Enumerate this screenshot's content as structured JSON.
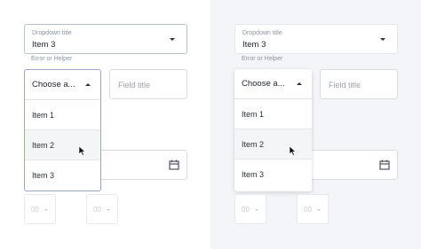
{
  "left": {
    "dropdown_label": "Dropdown title",
    "dropdown_value": "Item 3",
    "helper": "Error or Helper",
    "open_select": {
      "placeholder": "Choose a...",
      "items": [
        "Item 1",
        "Item 2",
        "Item 3"
      ],
      "hovered_item": "Item 2"
    },
    "field_title": "Field title",
    "time_hours": "00",
    "time_minutes": "00"
  },
  "right": {
    "dropdown_label": "Dropdown title",
    "dropdown_value": "Item 3",
    "helper": "Error or Helper",
    "open_select": {
      "placeholder": "Choose a...",
      "items": [
        "Item 1",
        "Item 2",
        "Item 3"
      ],
      "hovered_item": "Item 2"
    },
    "field_title": "Field title",
    "time_hours": "00",
    "time_minutes": "00"
  },
  "colors": {
    "left_background": "#ffffff",
    "right_background": "#f3f5f8",
    "open_border": "#9aa6c8",
    "placeholder_text": "#9aa2ad"
  },
  "icons": [
    "caret-down-icon",
    "caret-up-icon",
    "calendar-icon",
    "cursor-icon"
  ]
}
